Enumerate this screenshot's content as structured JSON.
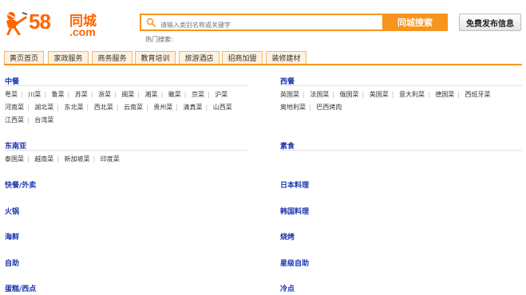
{
  "logo": {
    "number": "58",
    "cn": "同城",
    "domain": ".com"
  },
  "search": {
    "placeholder": "请输入类别名称或关键字",
    "button": "同城搜索",
    "hot_label": "热门搜索:"
  },
  "post_button": "免费发布信息",
  "nav": {
    "tabs": [
      "黄页首页",
      "家政服务",
      "商务服务",
      "教育培训",
      "旅游酒店",
      "招商加盟",
      "装修建材"
    ]
  },
  "categories": {
    "zhongcan": {
      "title": "中餐",
      "row1": [
        "粤菜",
        "川菜",
        "鲁菜",
        "苏菜",
        "浙菜",
        "闽菜",
        "湘菜",
        "徽菜",
        "京菜",
        "沪菜"
      ],
      "row2": [
        "河南菜",
        "湖北菜",
        "东北菜",
        "西北菜",
        "云南菜",
        "贵州菜",
        "清真菜",
        "山西菜"
      ],
      "row3": [
        "江西菜",
        "台湾菜"
      ]
    },
    "xican": {
      "title": "西餐",
      "row1": [
        "英国菜",
        "法国菜",
        "俄国菜",
        "美国菜",
        "意大利菜",
        "德国菜",
        "西班牙菜"
      ],
      "row2": [
        "奥地利菜",
        "巴西烤肉"
      ]
    },
    "dongnanya": {
      "title": "东南亚",
      "row1": [
        "泰国菜",
        "越南菜",
        "新加坡菜",
        "印度菜"
      ]
    },
    "sushi": {
      "title": "素食"
    },
    "kuaican": {
      "title": "快餐/外卖"
    },
    "riben": {
      "title": "日本料理"
    },
    "huoguo": {
      "title": "火锅"
    },
    "hanguo": {
      "title": "韩国料理"
    },
    "haixian": {
      "title": "海鲜"
    },
    "shaokao": {
      "title": "烧烤"
    },
    "zizhu": {
      "title": "自助"
    },
    "xingji": {
      "title": "星级自助"
    },
    "dangao": {
      "title": "蛋糕/西点"
    },
    "lengdian": {
      "title": "冷点"
    }
  },
  "colors": {
    "accent": "#f7941d",
    "link_title": "#1a35b0",
    "logo": "#ff6600"
  }
}
